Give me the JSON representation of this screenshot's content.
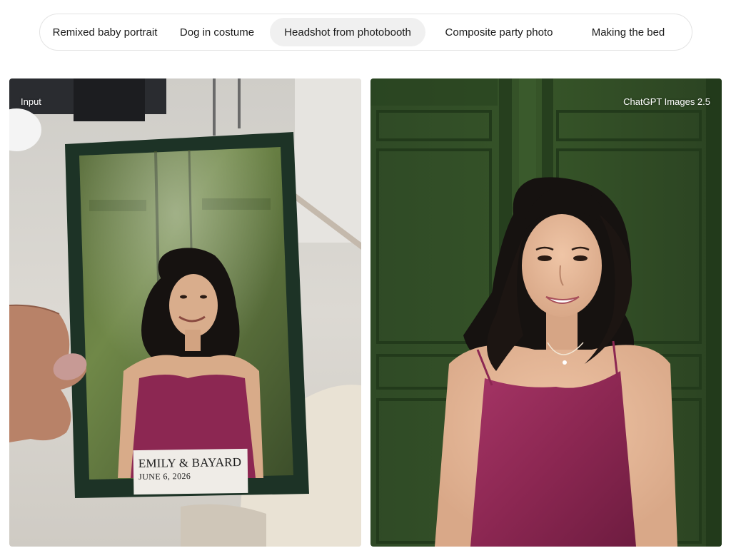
{
  "tabs": [
    {
      "label": "Remixed baby portrait",
      "active": false
    },
    {
      "label": "Dog in costume",
      "active": false
    },
    {
      "label": "Headshot from photobooth",
      "active": true
    },
    {
      "label": "Composite party photo",
      "active": false
    },
    {
      "label": "Making the bed",
      "active": false
    }
  ],
  "input_panel": {
    "label": "Input",
    "caption_names": "EMILY & BAYARD",
    "caption_date": "JUNE 6, 2026"
  },
  "output_panel": {
    "label": "ChatGPT Images 2.5"
  },
  "colors": {
    "door_green": "#2f4a26",
    "dress_magenta": "#8c2752",
    "hair": "#161210",
    "skin": "#e2b696"
  }
}
